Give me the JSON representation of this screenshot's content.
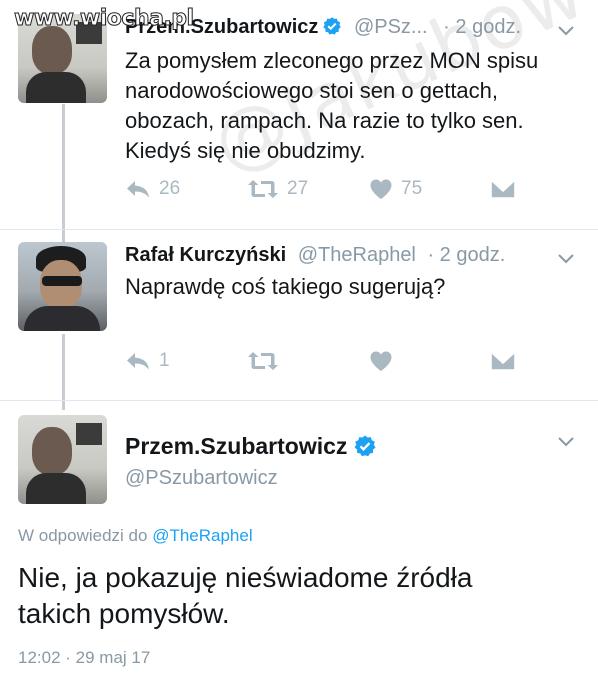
{
  "watermarks": {
    "top": "www.wiocha.pl",
    "diagonal": "@Jakubowy-"
  },
  "tweets": [
    {
      "name": "Przem.Szubartowicz",
      "handle": "@PSz...",
      "time": "· 2 godz.",
      "text": "Za pomysłem zleconego przez MON spisu\nnarodowościowego stoi sen o gettach,\nobozach, rampach. Na razie to tylko sen.\nKiedyś się nie obudzimy.",
      "reply_count": "26",
      "retweet_count": "27",
      "like_count": "75"
    },
    {
      "name": "Rafał Kurczyński",
      "handle": "@TheRaphel",
      "time": "· 2 godz.",
      "text": "Naprawdę coś takiego sugerują?",
      "reply_count": "1",
      "retweet_count": "",
      "like_count": ""
    }
  ],
  "focused": {
    "name": "Przem.Szubartowicz",
    "handle": "@PSzubartowicz",
    "reply_prefix": "W odpowiedzi do ",
    "reply_to": "@TheRaphel",
    "text": "Nie, ja pokazuję nieświadome źródła\ntakich pomysłów.",
    "timestamp": "12:02 · 29 maj 17"
  },
  "icons": {
    "verified": "verified-badge-icon",
    "reply": "reply-icon",
    "retweet": "retweet-icon",
    "like": "heart-icon",
    "dm": "direct-message-icon",
    "menu": "chevron-down-icon"
  },
  "colors": {
    "accent": "#1da1f2",
    "muted": "#8899a6",
    "icon": "#aab8c2",
    "text": "#14171a"
  }
}
